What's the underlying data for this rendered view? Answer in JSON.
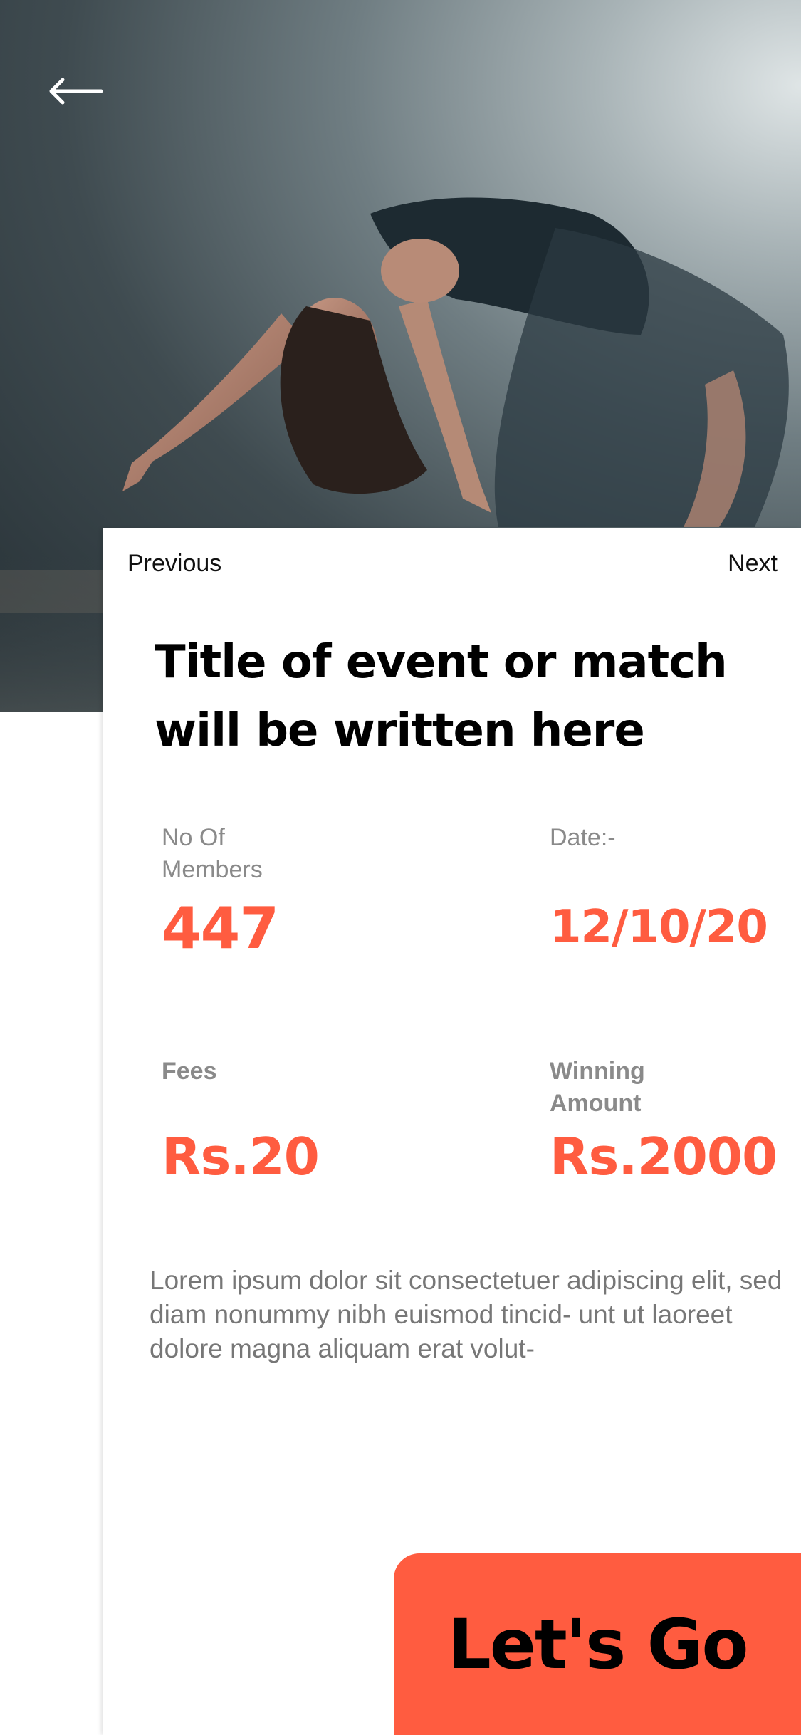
{
  "nav": {
    "previous_label": "Previous",
    "next_label": "Next"
  },
  "event": {
    "title": "Title of event or match will be written here",
    "members_label": "No Of Members",
    "members_value": "447",
    "date_label": "Date:-",
    "date_value": "12/10/20",
    "fees_label": "Fees",
    "fees_value": "Rs.20",
    "winning_label": "Winning Amount",
    "winning_value": "Rs.2000",
    "description": "Lorem ipsum dolor sit consectetuer adipiscing elit, sed diam nonummy nibh euismod tincid- unt ut laoreet dolore magna aliquam erat volut-"
  },
  "cta": {
    "label": "Let's Go"
  },
  "icons": {
    "back": "arrow-left-icon"
  },
  "colors": {
    "accent": "#ff5c40",
    "text_muted": "#8a8a8a",
    "card": "#ffffff"
  }
}
